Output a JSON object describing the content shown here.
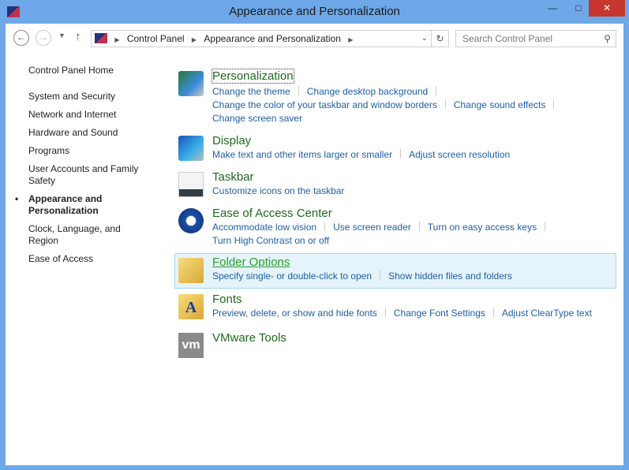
{
  "window": {
    "title": "Appearance and Personalization",
    "minimize": "—",
    "maximize": "□",
    "close": "✕"
  },
  "address": {
    "segments": [
      "Control Panel",
      "Appearance and Personalization"
    ],
    "search_placeholder": "Search Control Panel"
  },
  "sidebar": {
    "items": [
      {
        "label": "Control Panel Home"
      },
      {
        "label": "System and Security"
      },
      {
        "label": "Network and Internet"
      },
      {
        "label": "Hardware and Sound"
      },
      {
        "label": "Programs"
      },
      {
        "label": "User Accounts and Family Safety"
      },
      {
        "label": "Appearance and Personalization",
        "current": true
      },
      {
        "label": "Clock, Language, and Region"
      },
      {
        "label": "Ease of Access"
      }
    ]
  },
  "categories": [
    {
      "title": "Personalization",
      "icon": "personalization-icon",
      "links": [
        "Change the theme",
        "Change desktop background",
        "Change the color of your taskbar and window borders",
        "Change sound effects",
        "Change screen saver"
      ]
    },
    {
      "title": "Display",
      "icon": "display-icon",
      "links": [
        "Make text and other items larger or smaller",
        "Adjust screen resolution"
      ]
    },
    {
      "title": "Taskbar",
      "icon": "taskbar-icon",
      "links": [
        "Customize icons on the taskbar"
      ]
    },
    {
      "title": "Ease of Access Center",
      "icon": "ease-of-access-icon",
      "links": [
        "Accommodate low vision",
        "Use screen reader",
        "Turn on easy access keys",
        "Turn High Contrast on or off"
      ]
    },
    {
      "title": "Folder Options",
      "icon": "folder-icon",
      "links": [
        "Specify single- or double-click to open",
        "Show hidden files and folders"
      ]
    },
    {
      "title": "Fonts",
      "icon": "fonts-icon",
      "links": [
        "Preview, delete, or show and hide fonts",
        "Change Font Settings",
        "Adjust ClearType text"
      ]
    },
    {
      "title": "VMware Tools",
      "icon": "vmware-icon",
      "links": []
    }
  ]
}
